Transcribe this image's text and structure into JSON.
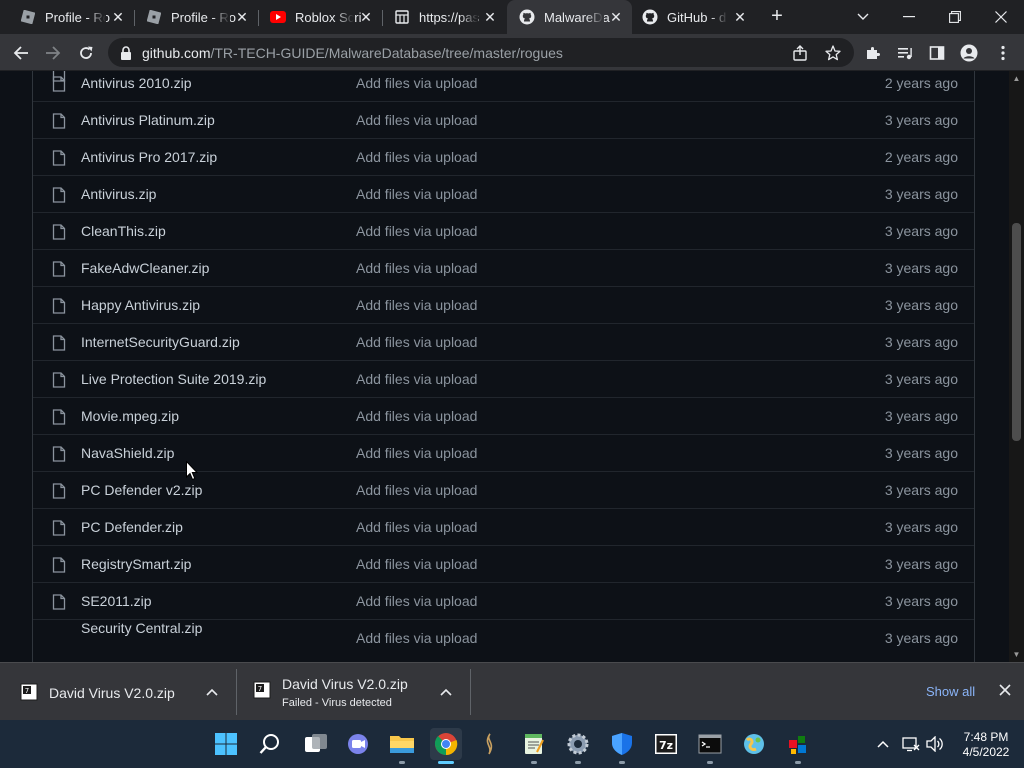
{
  "browser": {
    "tabs": [
      {
        "label": "Profile - Ro",
        "icon": "roblox-favicon",
        "active": false
      },
      {
        "label": "Profile - Ro",
        "icon": "roblox-favicon",
        "active": false
      },
      {
        "label": "Roblox Scri",
        "icon": "youtube-favicon",
        "active": false
      },
      {
        "label": "https://pas",
        "icon": "pastebin-favicon",
        "active": false
      },
      {
        "label": "MalwareDa",
        "icon": "github-favicon",
        "active": true
      },
      {
        "label": "GitHub - d",
        "icon": "github-favicon",
        "active": false
      }
    ],
    "close_glyph": "✕",
    "new_tab_glyph": "+",
    "url_host": "github.com",
    "url_path": "/TR-TECH-GUIDE/MalwareDatabase/tree/master/rogues"
  },
  "files": {
    "commit_message": "Add files via upload",
    "rows": [
      {
        "name": "Antivirus 2010.zip",
        "age": "2 years ago"
      },
      {
        "name": "Antivirus Platinum.zip",
        "age": "3 years ago"
      },
      {
        "name": "Antivirus Pro 2017.zip",
        "age": "2 years ago"
      },
      {
        "name": "Antivirus.zip",
        "age": "3 years ago"
      },
      {
        "name": "CleanThis.zip",
        "age": "3 years ago"
      },
      {
        "name": "FakeAdwCleaner.zip",
        "age": "3 years ago"
      },
      {
        "name": "Happy Antivirus.zip",
        "age": "3 years ago"
      },
      {
        "name": "InternetSecurityGuard.zip",
        "age": "3 years ago"
      },
      {
        "name": "Live Protection Suite 2019.zip",
        "age": "3 years ago"
      },
      {
        "name": "Movie.mpeg.zip",
        "age": "3 years ago"
      },
      {
        "name": "NavaShield.zip",
        "age": "3 years ago"
      },
      {
        "name": "PC Defender v2.zip",
        "age": "3 years ago"
      },
      {
        "name": "PC Defender.zip",
        "age": "3 years ago"
      },
      {
        "name": "RegistrySmart.zip",
        "age": "3 years ago"
      },
      {
        "name": "SE2011.zip",
        "age": "3 years ago"
      },
      {
        "name": "Security Central.zip",
        "age": "3 years ago"
      }
    ]
  },
  "downloads": {
    "items": [
      {
        "name": "David Virus V2.0.zip",
        "status": ""
      },
      {
        "name": "David Virus V2.0.zip",
        "status": "Failed - Virus detected"
      }
    ],
    "show_all": "Show all"
  },
  "taskbar": {
    "time": "7:48 PM",
    "date": "4/5/2022",
    "apps": [
      "windows-start-icon",
      "search-icon",
      "task-view-icon",
      "chat-icon",
      "file-explorer-icon",
      "chrome-icon",
      "app-icon",
      "notepad-icon",
      "settings-icon",
      "defender-icon",
      "7zip-icon",
      "terminal-icon",
      "paint-icon",
      "app-icon"
    ]
  },
  "colors": {
    "page_bg": "#0d1117",
    "text_primary": "#c9d1d9",
    "text_muted": "#8b949e",
    "link": "#8ab4f8"
  }
}
